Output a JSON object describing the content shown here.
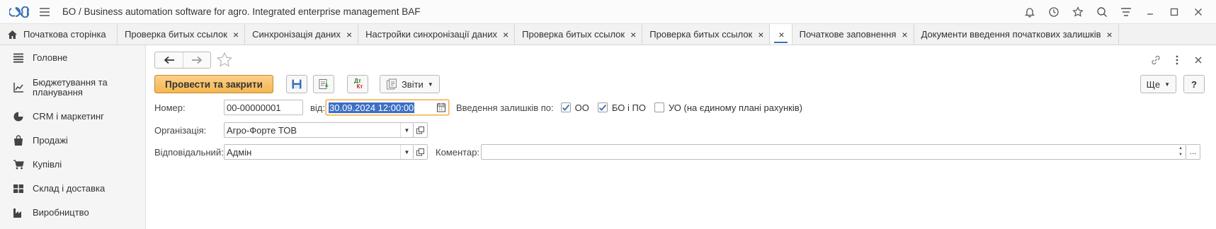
{
  "app": {
    "title": "БО / Business automation software for agro. Integrated enterprise management BAF"
  },
  "tabs": [
    {
      "label": "Початкова сторінка",
      "closable": false
    },
    {
      "label": "Проверка битых ссылок",
      "closable": true
    },
    {
      "label": "Синхронізація даних",
      "closable": true
    },
    {
      "label": "Настройки синхронізації даних",
      "closable": true
    },
    {
      "label": "Проверка битых ссылок",
      "closable": true
    },
    {
      "label": "Проверка битых ссылок",
      "closable": true
    },
    {
      "label": "",
      "closable": true,
      "active": true
    },
    {
      "label": "Початкове заповнення",
      "closable": true
    },
    {
      "label": "Документи введення початкових залишків",
      "closable": true
    }
  ],
  "tab_close_glyph": "×",
  "sidebar": {
    "items": [
      {
        "label": "Головне",
        "icon": "list-icon"
      },
      {
        "label": "Бюджетування та планування",
        "icon": "chart-line-icon"
      },
      {
        "label": "CRM і маркетинг",
        "icon": "pie-chart-icon"
      },
      {
        "label": "Продажі",
        "icon": "shopping-bag-icon"
      },
      {
        "label": "Купівлі",
        "icon": "cart-icon"
      },
      {
        "label": "Склад і доставка",
        "icon": "grid-icon"
      },
      {
        "label": "Виробництво",
        "icon": "factory-icon"
      }
    ]
  },
  "toolbar": {
    "post_close_label": "Провести та закрити",
    "dtkt_label_top": "Дт",
    "dtkt_label_bottom": "Кт",
    "reports_label": "Звіти",
    "more_label": "Ще",
    "help_label": "?"
  },
  "form": {
    "number_label": "Номер:",
    "number_value": "00-00000001",
    "date_label": "від:",
    "date_value": "30.09.2024 12:00:00",
    "balances_label": "Введення залишків по:",
    "checkboxes": [
      {
        "label": "ОО",
        "checked": true
      },
      {
        "label": "БО і ПО",
        "checked": true
      },
      {
        "label": "УО (на єдиному плані рахунків)",
        "checked": false
      }
    ],
    "organization_label": "Організація:",
    "organization_value": "Агро-Форте ТОВ",
    "responsible_label": "Відповідальний:",
    "responsible_value": "Адмін",
    "comment_label": "Коментар:",
    "comment_value": "",
    "comment_more": "..."
  },
  "colors": {
    "accent": "#3870b5",
    "primary_button": "#f5b64f",
    "selection": "#3c6fc5",
    "checkbox": "#3870b5"
  }
}
